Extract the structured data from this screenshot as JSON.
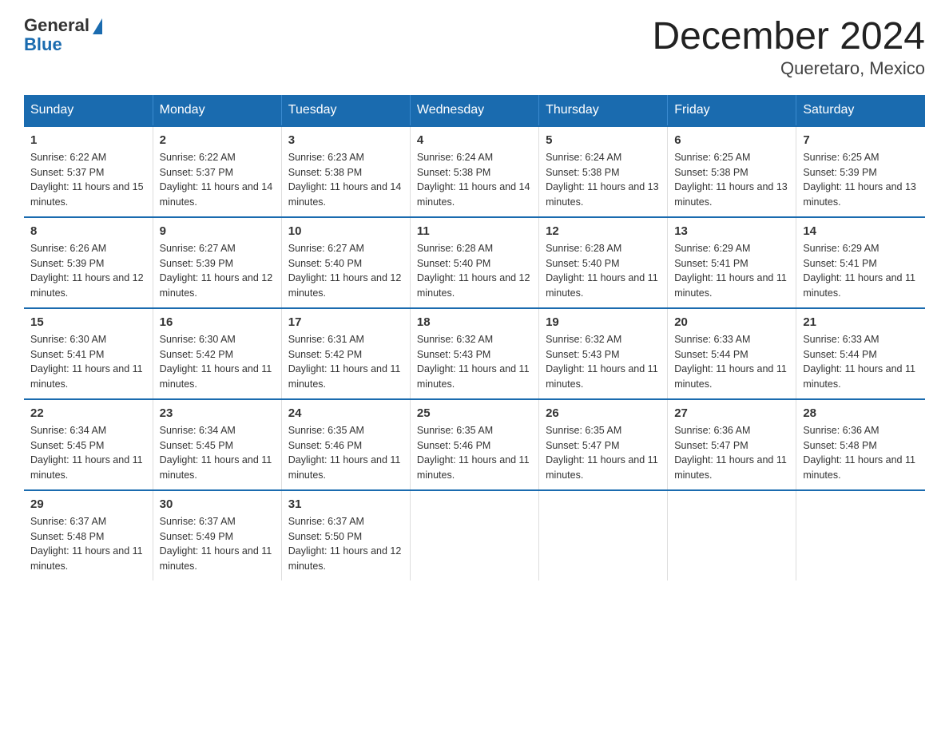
{
  "logo": {
    "text_general": "General",
    "text_blue": "Blue"
  },
  "title": "December 2024",
  "subtitle": "Queretaro, Mexico",
  "days_of_week": [
    "Sunday",
    "Monday",
    "Tuesday",
    "Wednesday",
    "Thursday",
    "Friday",
    "Saturday"
  ],
  "weeks": [
    [
      {
        "day": "1",
        "sunrise": "6:22 AM",
        "sunset": "5:37 PM",
        "daylight": "11 hours and 15 minutes."
      },
      {
        "day": "2",
        "sunrise": "6:22 AM",
        "sunset": "5:37 PM",
        "daylight": "11 hours and 14 minutes."
      },
      {
        "day": "3",
        "sunrise": "6:23 AM",
        "sunset": "5:38 PM",
        "daylight": "11 hours and 14 minutes."
      },
      {
        "day": "4",
        "sunrise": "6:24 AM",
        "sunset": "5:38 PM",
        "daylight": "11 hours and 14 minutes."
      },
      {
        "day": "5",
        "sunrise": "6:24 AM",
        "sunset": "5:38 PM",
        "daylight": "11 hours and 13 minutes."
      },
      {
        "day": "6",
        "sunrise": "6:25 AM",
        "sunset": "5:38 PM",
        "daylight": "11 hours and 13 minutes."
      },
      {
        "day": "7",
        "sunrise": "6:25 AM",
        "sunset": "5:39 PM",
        "daylight": "11 hours and 13 minutes."
      }
    ],
    [
      {
        "day": "8",
        "sunrise": "6:26 AM",
        "sunset": "5:39 PM",
        "daylight": "11 hours and 12 minutes."
      },
      {
        "day": "9",
        "sunrise": "6:27 AM",
        "sunset": "5:39 PM",
        "daylight": "11 hours and 12 minutes."
      },
      {
        "day": "10",
        "sunrise": "6:27 AM",
        "sunset": "5:40 PM",
        "daylight": "11 hours and 12 minutes."
      },
      {
        "day": "11",
        "sunrise": "6:28 AM",
        "sunset": "5:40 PM",
        "daylight": "11 hours and 12 minutes."
      },
      {
        "day": "12",
        "sunrise": "6:28 AM",
        "sunset": "5:40 PM",
        "daylight": "11 hours and 11 minutes."
      },
      {
        "day": "13",
        "sunrise": "6:29 AM",
        "sunset": "5:41 PM",
        "daylight": "11 hours and 11 minutes."
      },
      {
        "day": "14",
        "sunrise": "6:29 AM",
        "sunset": "5:41 PM",
        "daylight": "11 hours and 11 minutes."
      }
    ],
    [
      {
        "day": "15",
        "sunrise": "6:30 AM",
        "sunset": "5:41 PM",
        "daylight": "11 hours and 11 minutes."
      },
      {
        "day": "16",
        "sunrise": "6:30 AM",
        "sunset": "5:42 PM",
        "daylight": "11 hours and 11 minutes."
      },
      {
        "day": "17",
        "sunrise": "6:31 AM",
        "sunset": "5:42 PM",
        "daylight": "11 hours and 11 minutes."
      },
      {
        "day": "18",
        "sunrise": "6:32 AM",
        "sunset": "5:43 PM",
        "daylight": "11 hours and 11 minutes."
      },
      {
        "day": "19",
        "sunrise": "6:32 AM",
        "sunset": "5:43 PM",
        "daylight": "11 hours and 11 minutes."
      },
      {
        "day": "20",
        "sunrise": "6:33 AM",
        "sunset": "5:44 PM",
        "daylight": "11 hours and 11 minutes."
      },
      {
        "day": "21",
        "sunrise": "6:33 AM",
        "sunset": "5:44 PM",
        "daylight": "11 hours and 11 minutes."
      }
    ],
    [
      {
        "day": "22",
        "sunrise": "6:34 AM",
        "sunset": "5:45 PM",
        "daylight": "11 hours and 11 minutes."
      },
      {
        "day": "23",
        "sunrise": "6:34 AM",
        "sunset": "5:45 PM",
        "daylight": "11 hours and 11 minutes."
      },
      {
        "day": "24",
        "sunrise": "6:35 AM",
        "sunset": "5:46 PM",
        "daylight": "11 hours and 11 minutes."
      },
      {
        "day": "25",
        "sunrise": "6:35 AM",
        "sunset": "5:46 PM",
        "daylight": "11 hours and 11 minutes."
      },
      {
        "day": "26",
        "sunrise": "6:35 AM",
        "sunset": "5:47 PM",
        "daylight": "11 hours and 11 minutes."
      },
      {
        "day": "27",
        "sunrise": "6:36 AM",
        "sunset": "5:47 PM",
        "daylight": "11 hours and 11 minutes."
      },
      {
        "day": "28",
        "sunrise": "6:36 AM",
        "sunset": "5:48 PM",
        "daylight": "11 hours and 11 minutes."
      }
    ],
    [
      {
        "day": "29",
        "sunrise": "6:37 AM",
        "sunset": "5:48 PM",
        "daylight": "11 hours and 11 minutes."
      },
      {
        "day": "30",
        "sunrise": "6:37 AM",
        "sunset": "5:49 PM",
        "daylight": "11 hours and 11 minutes."
      },
      {
        "day": "31",
        "sunrise": "6:37 AM",
        "sunset": "5:50 PM",
        "daylight": "11 hours and 12 minutes."
      },
      null,
      null,
      null,
      null
    ]
  ]
}
